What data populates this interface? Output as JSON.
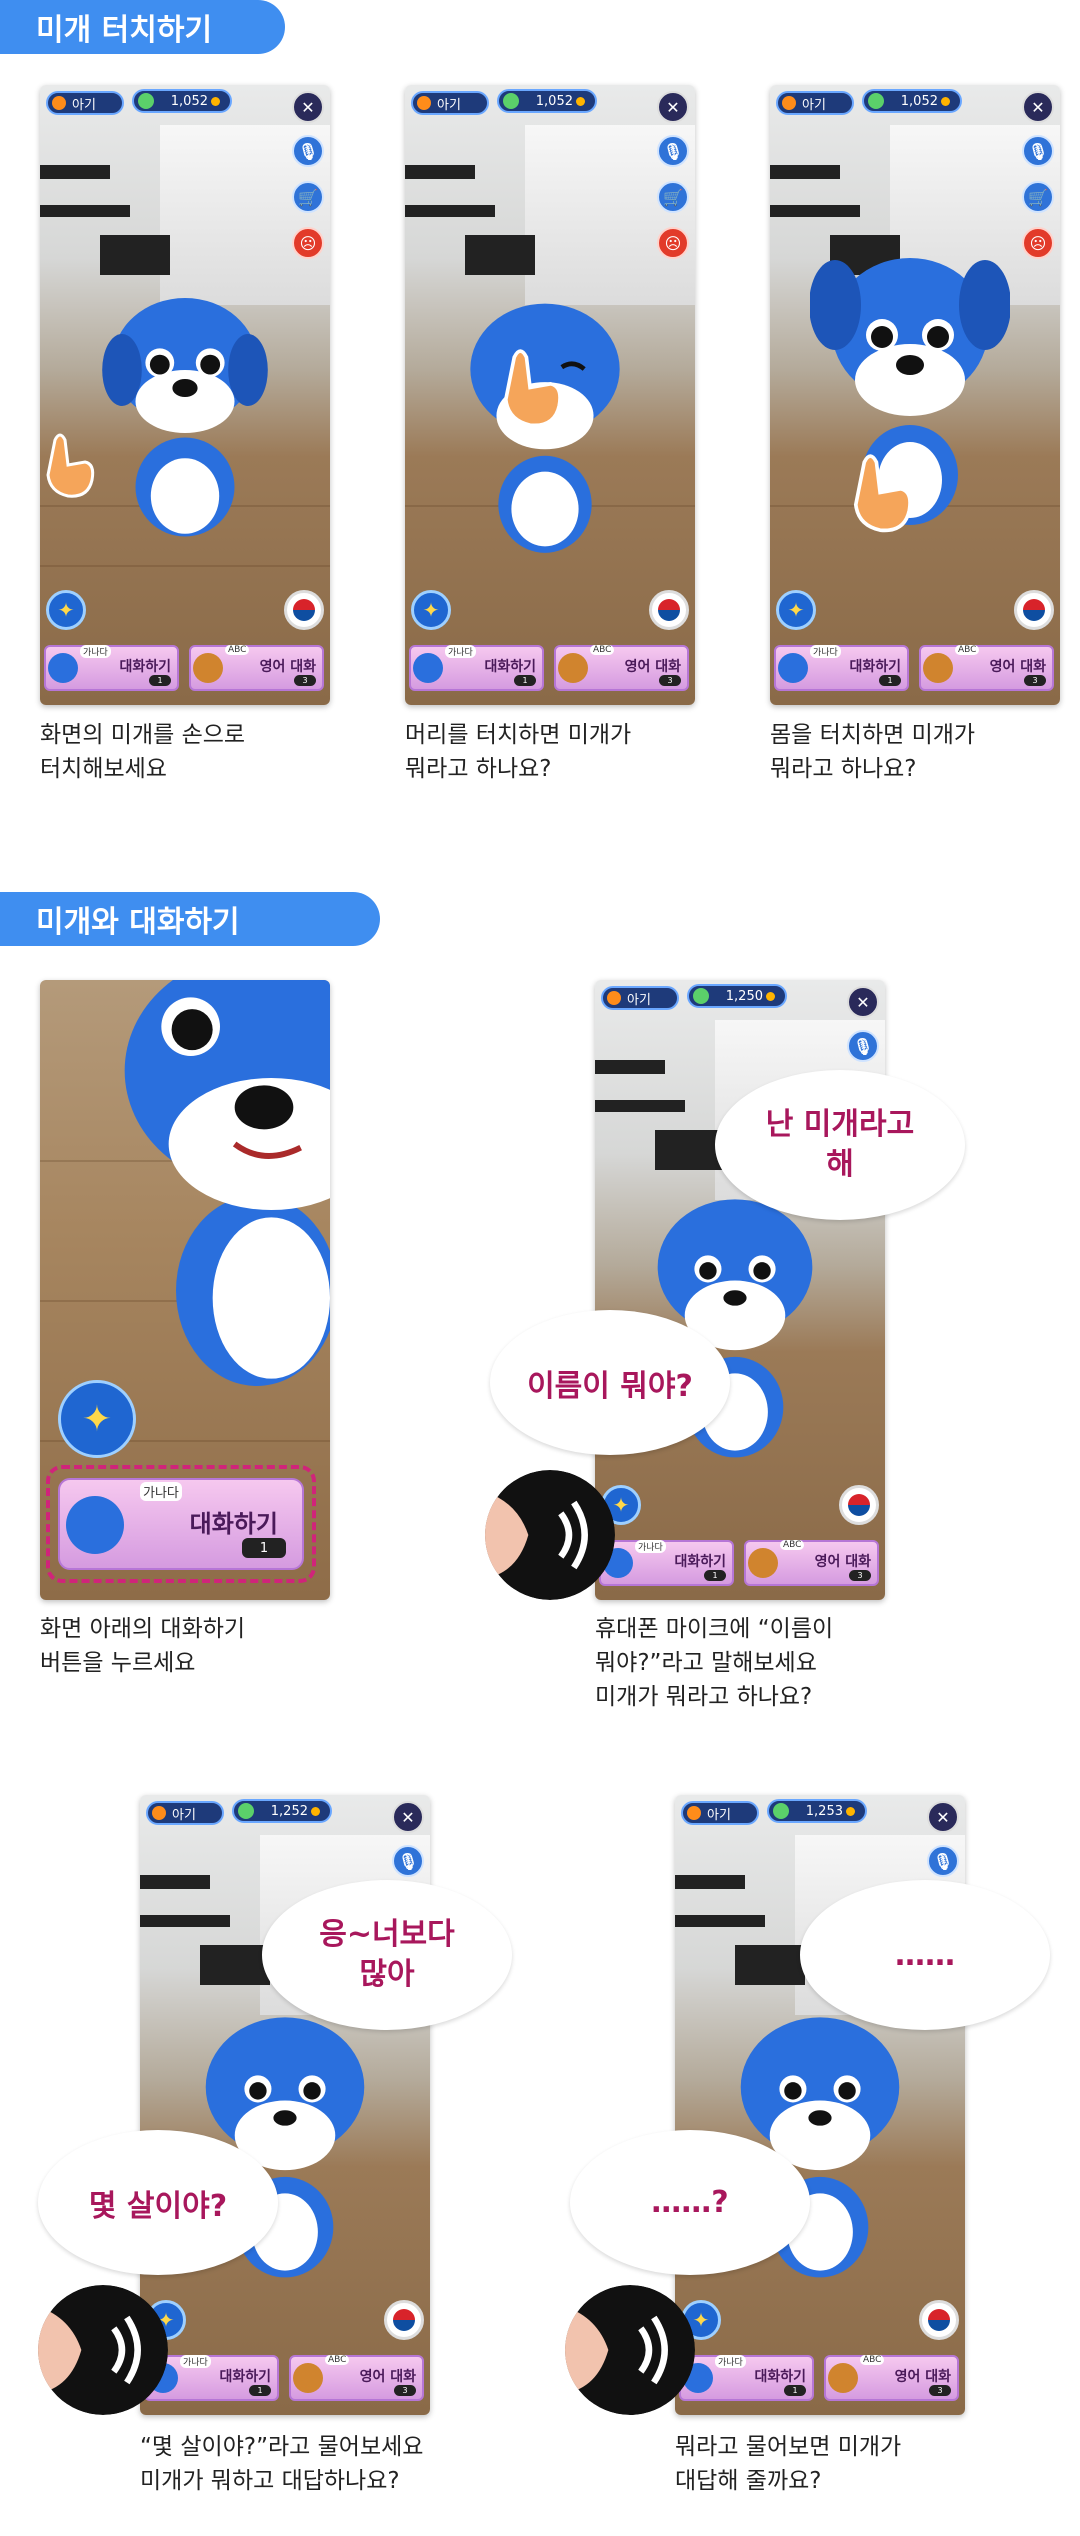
{
  "sections": {
    "touch_title": "미개 터치하기",
    "talk_title": "미개와 대화하기"
  },
  "app": {
    "baby_label": "아기",
    "talk_button": "대화하기",
    "talk_tag": "가나다",
    "english_button": "영어 대화",
    "english_tag": "ABC",
    "talk_cost": "1",
    "english_cost": "3"
  },
  "screens": [
    {
      "coins": "1,052",
      "caption": "화면의 미개를 손으로\n터치해보세요"
    },
    {
      "coins": "1,052",
      "caption": "머리를 터치하면 미개가\n뭐라고 하나요?"
    },
    {
      "coins": "1,052",
      "caption": "몸을 터치하면 미개가\n뭐라고 하나요?"
    },
    {
      "caption": "화면 아래의 대화하기\n버튼을 누르세요"
    },
    {
      "coins": "1,250",
      "caption": "휴대폰 마이크에 “이름이\n뭐야?”라고 말해보세요\n미개가 뭐라고 하나요?",
      "dog_says": "난 미개라고\n해",
      "user_says": "이름이 뭐야?"
    },
    {
      "coins": "1,252",
      "caption": "“몇 살이야?”라고 물어보세요\n미개가 뭐하고 대답하나요?",
      "dog_says": "응~너보다\n많아",
      "user_says": "몇 살이야?"
    },
    {
      "coins": "1,253",
      "caption": "뭐라고 물어보면 미개가\n대답해 줄까요?",
      "dog_says": "……",
      "user_says": "……?"
    }
  ],
  "colors": {
    "accent": "#3f8ef0",
    "speech": "#a8175c",
    "dog_blue": "#2a6fdd"
  },
  "icons": [
    "close-icon",
    "mic-icon",
    "cart-icon",
    "angry-face-icon",
    "magic-wand-icon",
    "korea-flag-icon",
    "pointing-hand-icon",
    "ear-icon"
  ]
}
